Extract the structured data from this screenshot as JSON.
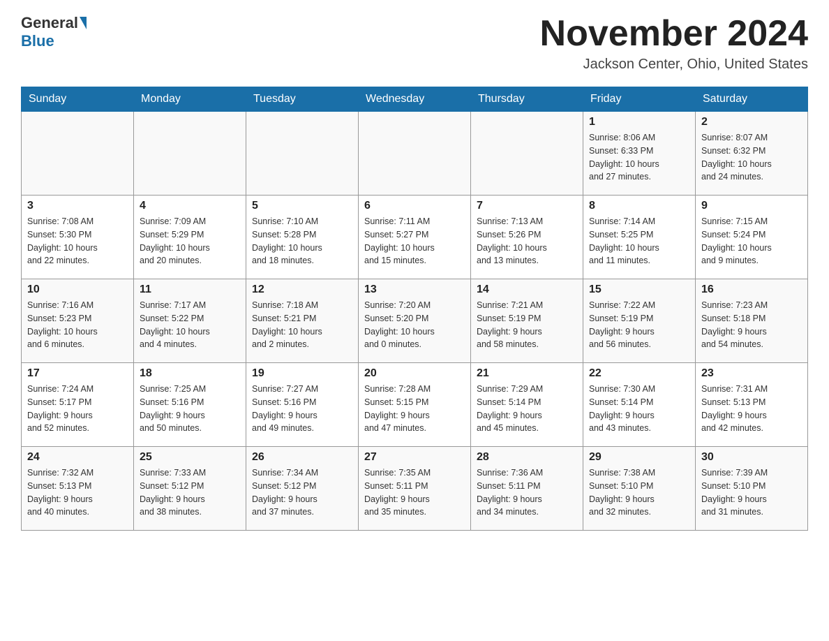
{
  "header": {
    "logo_general": "General",
    "logo_blue": "Blue",
    "month_title": "November 2024",
    "location": "Jackson Center, Ohio, United States"
  },
  "weekdays": [
    "Sunday",
    "Monday",
    "Tuesday",
    "Wednesday",
    "Thursday",
    "Friday",
    "Saturday"
  ],
  "weeks": [
    {
      "days": [
        {
          "num": "",
          "info": ""
        },
        {
          "num": "",
          "info": ""
        },
        {
          "num": "",
          "info": ""
        },
        {
          "num": "",
          "info": ""
        },
        {
          "num": "",
          "info": ""
        },
        {
          "num": "1",
          "info": "Sunrise: 8:06 AM\nSunset: 6:33 PM\nDaylight: 10 hours\nand 27 minutes."
        },
        {
          "num": "2",
          "info": "Sunrise: 8:07 AM\nSunset: 6:32 PM\nDaylight: 10 hours\nand 24 minutes."
        }
      ]
    },
    {
      "days": [
        {
          "num": "3",
          "info": "Sunrise: 7:08 AM\nSunset: 5:30 PM\nDaylight: 10 hours\nand 22 minutes."
        },
        {
          "num": "4",
          "info": "Sunrise: 7:09 AM\nSunset: 5:29 PM\nDaylight: 10 hours\nand 20 minutes."
        },
        {
          "num": "5",
          "info": "Sunrise: 7:10 AM\nSunset: 5:28 PM\nDaylight: 10 hours\nand 18 minutes."
        },
        {
          "num": "6",
          "info": "Sunrise: 7:11 AM\nSunset: 5:27 PM\nDaylight: 10 hours\nand 15 minutes."
        },
        {
          "num": "7",
          "info": "Sunrise: 7:13 AM\nSunset: 5:26 PM\nDaylight: 10 hours\nand 13 minutes."
        },
        {
          "num": "8",
          "info": "Sunrise: 7:14 AM\nSunset: 5:25 PM\nDaylight: 10 hours\nand 11 minutes."
        },
        {
          "num": "9",
          "info": "Sunrise: 7:15 AM\nSunset: 5:24 PM\nDaylight: 10 hours\nand 9 minutes."
        }
      ]
    },
    {
      "days": [
        {
          "num": "10",
          "info": "Sunrise: 7:16 AM\nSunset: 5:23 PM\nDaylight: 10 hours\nand 6 minutes."
        },
        {
          "num": "11",
          "info": "Sunrise: 7:17 AM\nSunset: 5:22 PM\nDaylight: 10 hours\nand 4 minutes."
        },
        {
          "num": "12",
          "info": "Sunrise: 7:18 AM\nSunset: 5:21 PM\nDaylight: 10 hours\nand 2 minutes."
        },
        {
          "num": "13",
          "info": "Sunrise: 7:20 AM\nSunset: 5:20 PM\nDaylight: 10 hours\nand 0 minutes."
        },
        {
          "num": "14",
          "info": "Sunrise: 7:21 AM\nSunset: 5:19 PM\nDaylight: 9 hours\nand 58 minutes."
        },
        {
          "num": "15",
          "info": "Sunrise: 7:22 AM\nSunset: 5:19 PM\nDaylight: 9 hours\nand 56 minutes."
        },
        {
          "num": "16",
          "info": "Sunrise: 7:23 AM\nSunset: 5:18 PM\nDaylight: 9 hours\nand 54 minutes."
        }
      ]
    },
    {
      "days": [
        {
          "num": "17",
          "info": "Sunrise: 7:24 AM\nSunset: 5:17 PM\nDaylight: 9 hours\nand 52 minutes."
        },
        {
          "num": "18",
          "info": "Sunrise: 7:25 AM\nSunset: 5:16 PM\nDaylight: 9 hours\nand 50 minutes."
        },
        {
          "num": "19",
          "info": "Sunrise: 7:27 AM\nSunset: 5:16 PM\nDaylight: 9 hours\nand 49 minutes."
        },
        {
          "num": "20",
          "info": "Sunrise: 7:28 AM\nSunset: 5:15 PM\nDaylight: 9 hours\nand 47 minutes."
        },
        {
          "num": "21",
          "info": "Sunrise: 7:29 AM\nSunset: 5:14 PM\nDaylight: 9 hours\nand 45 minutes."
        },
        {
          "num": "22",
          "info": "Sunrise: 7:30 AM\nSunset: 5:14 PM\nDaylight: 9 hours\nand 43 minutes."
        },
        {
          "num": "23",
          "info": "Sunrise: 7:31 AM\nSunset: 5:13 PM\nDaylight: 9 hours\nand 42 minutes."
        }
      ]
    },
    {
      "days": [
        {
          "num": "24",
          "info": "Sunrise: 7:32 AM\nSunset: 5:13 PM\nDaylight: 9 hours\nand 40 minutes."
        },
        {
          "num": "25",
          "info": "Sunrise: 7:33 AM\nSunset: 5:12 PM\nDaylight: 9 hours\nand 38 minutes."
        },
        {
          "num": "26",
          "info": "Sunrise: 7:34 AM\nSunset: 5:12 PM\nDaylight: 9 hours\nand 37 minutes."
        },
        {
          "num": "27",
          "info": "Sunrise: 7:35 AM\nSunset: 5:11 PM\nDaylight: 9 hours\nand 35 minutes."
        },
        {
          "num": "28",
          "info": "Sunrise: 7:36 AM\nSunset: 5:11 PM\nDaylight: 9 hours\nand 34 minutes."
        },
        {
          "num": "29",
          "info": "Sunrise: 7:38 AM\nSunset: 5:10 PM\nDaylight: 9 hours\nand 32 minutes."
        },
        {
          "num": "30",
          "info": "Sunrise: 7:39 AM\nSunset: 5:10 PM\nDaylight: 9 hours\nand 31 minutes."
        }
      ]
    }
  ]
}
